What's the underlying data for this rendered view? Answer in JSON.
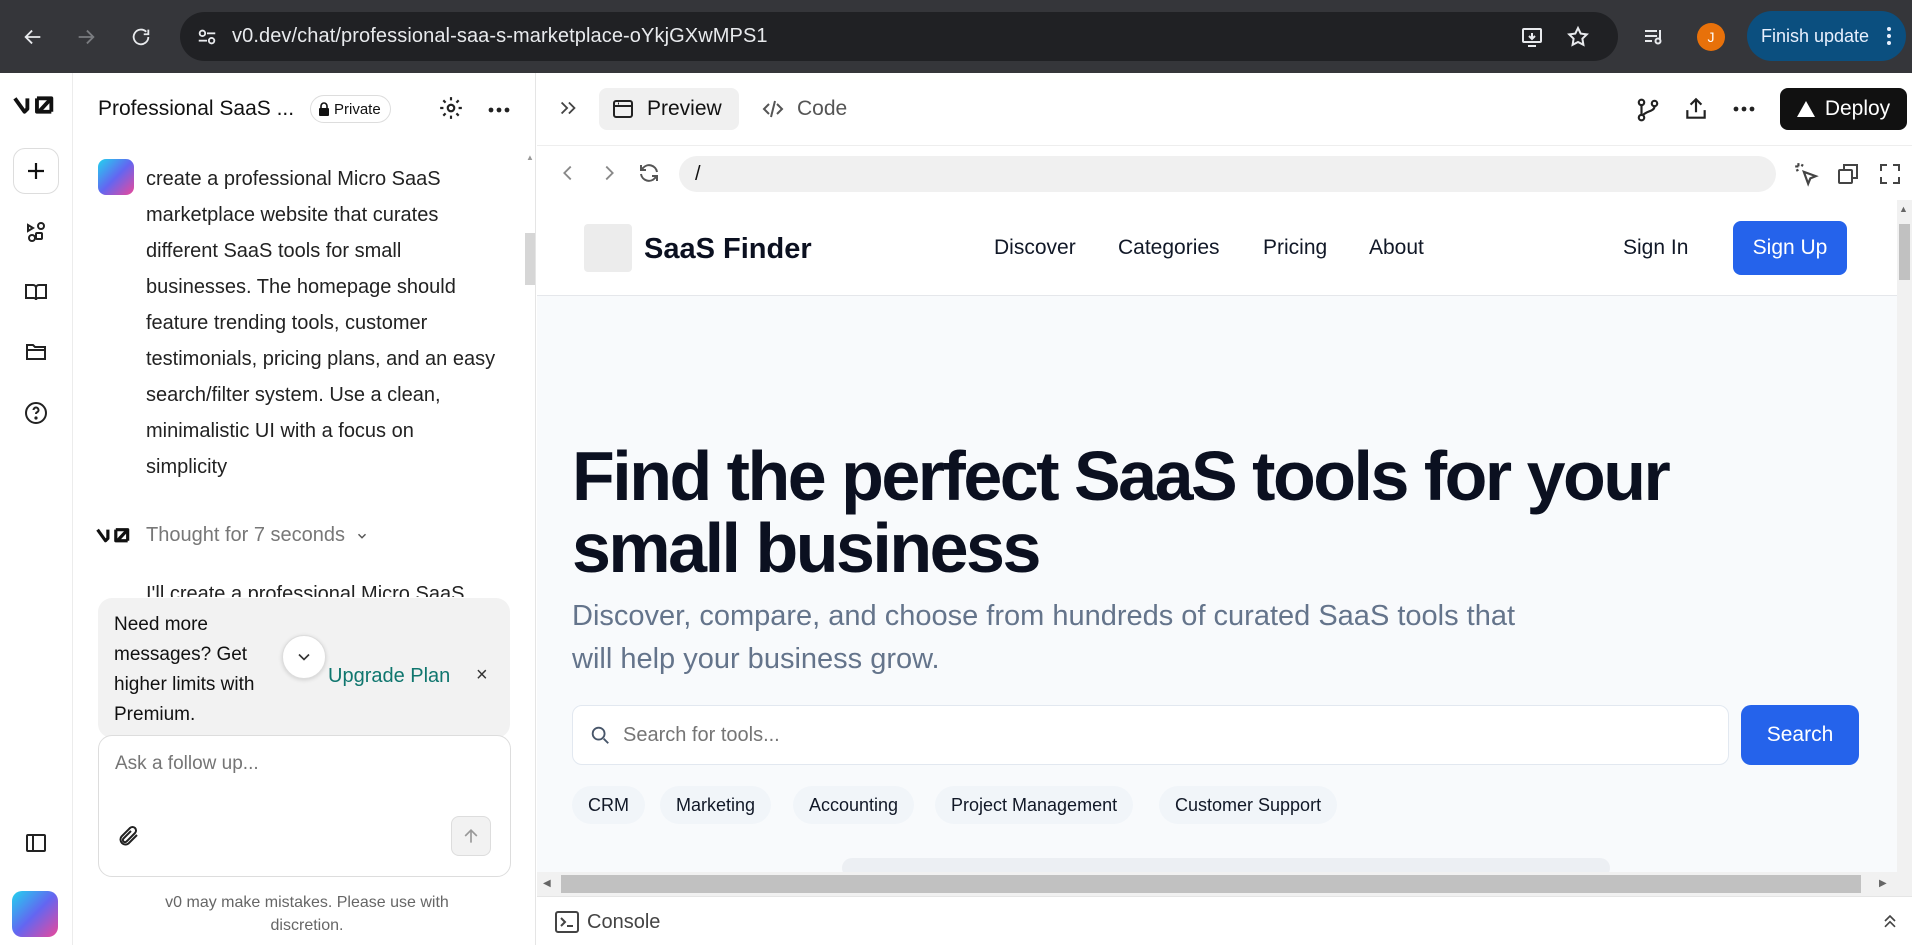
{
  "browser": {
    "url": "v0.dev/chat/professional-saa-s-marketplace-oYkjGXwMPS1",
    "profile_initial": "J",
    "finish_update": "Finish update"
  },
  "chat": {
    "title": "Professional SaaS ...",
    "private_label": "Private",
    "user_message": "create a professional Micro SaaS marketplace website that curates different SaaS tools for small businesses. The homepage should feature trending tools, customer testimonials, pricing plans, and an easy search/filter system. Use a clean, minimalistic UI with a focus on simplicity",
    "thought": "Thought for 7 seconds",
    "assistant_partial": "I'll create a professional Micro SaaS",
    "upgrade_text": "Need more messages? Get higher limits with Premium.",
    "upgrade_link": "Upgrade Plan",
    "followup_placeholder": "Ask a follow up...",
    "disclaimer": "v0 may make mistakes. Please use with discretion."
  },
  "toolbar": {
    "preview_tab": "Preview",
    "code_tab": "Code",
    "deploy": "Deploy",
    "path": "/"
  },
  "site": {
    "brand": "SaaS Finder",
    "nav": [
      "Discover",
      "Categories",
      "Pricing",
      "About"
    ],
    "sign_in": "Sign In",
    "sign_up": "Sign Up",
    "hero_title": "Find the perfect SaaS tools for your small business",
    "hero_subtitle": "Discover, compare, and choose from hundreds of curated SaaS tools that will help your business grow.",
    "search_placeholder": "Search for tools...",
    "search_button": "Search",
    "categories": [
      "CRM",
      "Marketing",
      "Accounting",
      "Project Management",
      "Customer Support"
    ]
  },
  "console": {
    "label": "Console"
  },
  "colors": {
    "accent": "#2563eb",
    "chrome": "#35363a",
    "finish_update": "#0b4f7f"
  }
}
